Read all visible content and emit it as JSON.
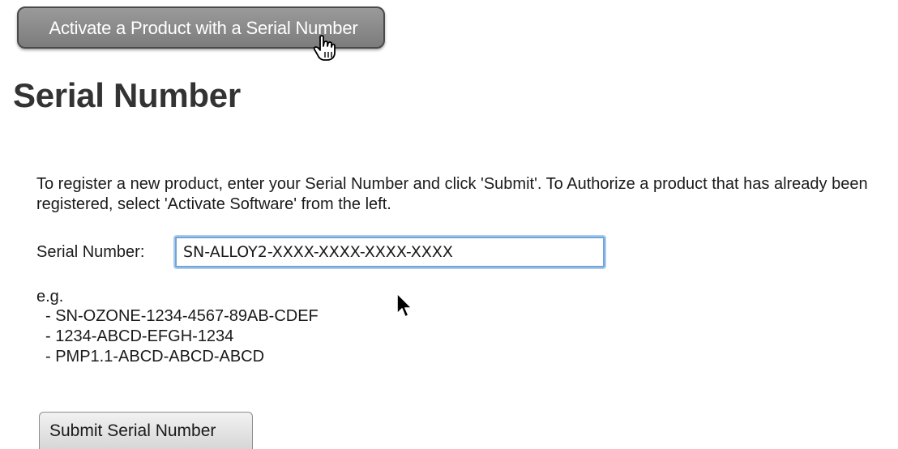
{
  "top_button": {
    "label": "Activate a Product with a Serial Number"
  },
  "page_title": "Serial Number",
  "intro_text": "To register a new product, enter your Serial Number and click 'Submit'. To Authorize a product that has already been registered, select 'Activate Software' from the left.",
  "serial_field": {
    "label": "Serial Number:",
    "value": "SN-ALLOY2-XXXX-XXXX-XXXX-XXXX"
  },
  "examples": {
    "label": "e.g.",
    "items": [
      "- SN-OZONE-1234-4567-89AB-CDEF",
      "- 1234-ABCD-EFGH-1234",
      "- PMP1.1-ABCD-ABCD-ABCD"
    ]
  },
  "submit_button": {
    "label": "Submit Serial Number"
  },
  "icons": {
    "hand_cursor": "hand-pointer-cursor-icon",
    "arrow_cursor": "arrow-cursor-icon"
  },
  "colors": {
    "top_button_bg": "#8a8a8a",
    "focus_ring": "#6fa4d8",
    "title": "#333333"
  }
}
